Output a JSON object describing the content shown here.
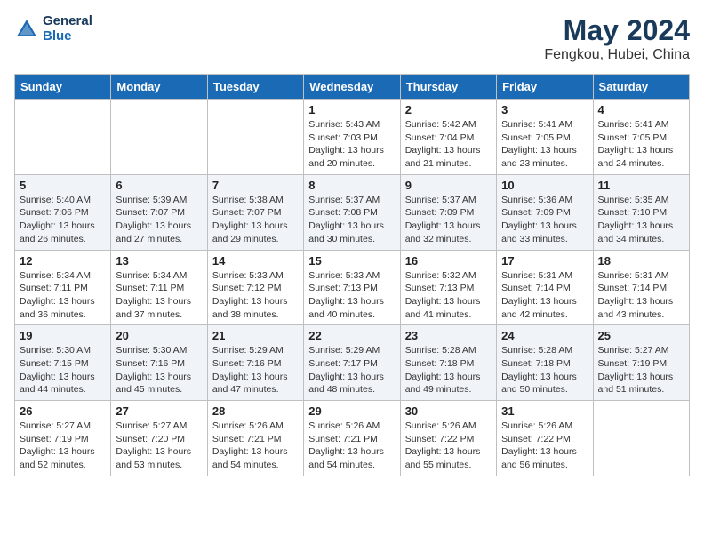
{
  "header": {
    "logo_line1": "General",
    "logo_line2": "Blue",
    "month": "May 2024",
    "location": "Fengkou, Hubei, China"
  },
  "weekdays": [
    "Sunday",
    "Monday",
    "Tuesday",
    "Wednesday",
    "Thursday",
    "Friday",
    "Saturday"
  ],
  "weeks": [
    [
      {
        "day": "",
        "info": ""
      },
      {
        "day": "",
        "info": ""
      },
      {
        "day": "",
        "info": ""
      },
      {
        "day": "1",
        "info": "Sunrise: 5:43 AM\nSunset: 7:03 PM\nDaylight: 13 hours\nand 20 minutes."
      },
      {
        "day": "2",
        "info": "Sunrise: 5:42 AM\nSunset: 7:04 PM\nDaylight: 13 hours\nand 21 minutes."
      },
      {
        "day": "3",
        "info": "Sunrise: 5:41 AM\nSunset: 7:05 PM\nDaylight: 13 hours\nand 23 minutes."
      },
      {
        "day": "4",
        "info": "Sunrise: 5:41 AM\nSunset: 7:05 PM\nDaylight: 13 hours\nand 24 minutes."
      }
    ],
    [
      {
        "day": "5",
        "info": "Sunrise: 5:40 AM\nSunset: 7:06 PM\nDaylight: 13 hours\nand 26 minutes."
      },
      {
        "day": "6",
        "info": "Sunrise: 5:39 AM\nSunset: 7:07 PM\nDaylight: 13 hours\nand 27 minutes."
      },
      {
        "day": "7",
        "info": "Sunrise: 5:38 AM\nSunset: 7:07 PM\nDaylight: 13 hours\nand 29 minutes."
      },
      {
        "day": "8",
        "info": "Sunrise: 5:37 AM\nSunset: 7:08 PM\nDaylight: 13 hours\nand 30 minutes."
      },
      {
        "day": "9",
        "info": "Sunrise: 5:37 AM\nSunset: 7:09 PM\nDaylight: 13 hours\nand 32 minutes."
      },
      {
        "day": "10",
        "info": "Sunrise: 5:36 AM\nSunset: 7:09 PM\nDaylight: 13 hours\nand 33 minutes."
      },
      {
        "day": "11",
        "info": "Sunrise: 5:35 AM\nSunset: 7:10 PM\nDaylight: 13 hours\nand 34 minutes."
      }
    ],
    [
      {
        "day": "12",
        "info": "Sunrise: 5:34 AM\nSunset: 7:11 PM\nDaylight: 13 hours\nand 36 minutes."
      },
      {
        "day": "13",
        "info": "Sunrise: 5:34 AM\nSunset: 7:11 PM\nDaylight: 13 hours\nand 37 minutes."
      },
      {
        "day": "14",
        "info": "Sunrise: 5:33 AM\nSunset: 7:12 PM\nDaylight: 13 hours\nand 38 minutes."
      },
      {
        "day": "15",
        "info": "Sunrise: 5:33 AM\nSunset: 7:13 PM\nDaylight: 13 hours\nand 40 minutes."
      },
      {
        "day": "16",
        "info": "Sunrise: 5:32 AM\nSunset: 7:13 PM\nDaylight: 13 hours\nand 41 minutes."
      },
      {
        "day": "17",
        "info": "Sunrise: 5:31 AM\nSunset: 7:14 PM\nDaylight: 13 hours\nand 42 minutes."
      },
      {
        "day": "18",
        "info": "Sunrise: 5:31 AM\nSunset: 7:14 PM\nDaylight: 13 hours\nand 43 minutes."
      }
    ],
    [
      {
        "day": "19",
        "info": "Sunrise: 5:30 AM\nSunset: 7:15 PM\nDaylight: 13 hours\nand 44 minutes."
      },
      {
        "day": "20",
        "info": "Sunrise: 5:30 AM\nSunset: 7:16 PM\nDaylight: 13 hours\nand 45 minutes."
      },
      {
        "day": "21",
        "info": "Sunrise: 5:29 AM\nSunset: 7:16 PM\nDaylight: 13 hours\nand 47 minutes."
      },
      {
        "day": "22",
        "info": "Sunrise: 5:29 AM\nSunset: 7:17 PM\nDaylight: 13 hours\nand 48 minutes."
      },
      {
        "day": "23",
        "info": "Sunrise: 5:28 AM\nSunset: 7:18 PM\nDaylight: 13 hours\nand 49 minutes."
      },
      {
        "day": "24",
        "info": "Sunrise: 5:28 AM\nSunset: 7:18 PM\nDaylight: 13 hours\nand 50 minutes."
      },
      {
        "day": "25",
        "info": "Sunrise: 5:27 AM\nSunset: 7:19 PM\nDaylight: 13 hours\nand 51 minutes."
      }
    ],
    [
      {
        "day": "26",
        "info": "Sunrise: 5:27 AM\nSunset: 7:19 PM\nDaylight: 13 hours\nand 52 minutes."
      },
      {
        "day": "27",
        "info": "Sunrise: 5:27 AM\nSunset: 7:20 PM\nDaylight: 13 hours\nand 53 minutes."
      },
      {
        "day": "28",
        "info": "Sunrise: 5:26 AM\nSunset: 7:21 PM\nDaylight: 13 hours\nand 54 minutes."
      },
      {
        "day": "29",
        "info": "Sunrise: 5:26 AM\nSunset: 7:21 PM\nDaylight: 13 hours\nand 54 minutes."
      },
      {
        "day": "30",
        "info": "Sunrise: 5:26 AM\nSunset: 7:22 PM\nDaylight: 13 hours\nand 55 minutes."
      },
      {
        "day": "31",
        "info": "Sunrise: 5:26 AM\nSunset: 7:22 PM\nDaylight: 13 hours\nand 56 minutes."
      },
      {
        "day": "",
        "info": ""
      }
    ]
  ]
}
